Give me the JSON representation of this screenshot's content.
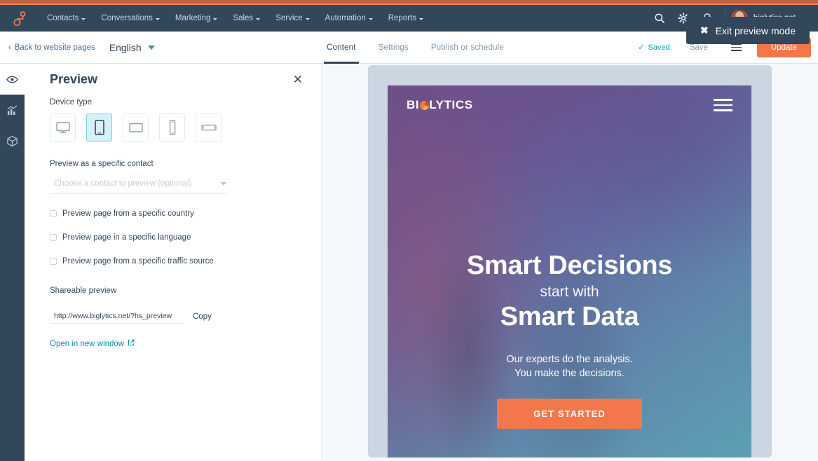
{
  "topbar": {
    "logo_icon": "hubspot-sprocket-icon",
    "nav_items": [
      {
        "label": "Contacts",
        "has_caret": true
      },
      {
        "label": "Conversations",
        "has_caret": true
      },
      {
        "label": "Marketing",
        "has_caret": true
      },
      {
        "label": "Sales",
        "has_caret": true
      },
      {
        "label": "Service",
        "has_caret": true
      },
      {
        "label": "Automation",
        "has_caret": true
      },
      {
        "label": "Reports",
        "has_caret": true
      }
    ],
    "icons": [
      "search-icon",
      "gear-icon",
      "bell-icon"
    ],
    "account_name": "biglytics.net",
    "avatar": "user-avatar"
  },
  "toolbar": {
    "back_label": "Back to website pages",
    "back_chevron": "‹",
    "language": "English",
    "tabs": [
      {
        "label": "Content",
        "active": true
      },
      {
        "label": "Settings",
        "active": false
      },
      {
        "label": "Publish or schedule",
        "active": false
      }
    ],
    "saved_label": "Saved",
    "saved_check": "✓",
    "save_label": "Save",
    "menu_icon": "hamburger-menu-icon",
    "update_label": "Update"
  },
  "rail": {
    "items": [
      {
        "name": "preview-eye-icon",
        "active": true
      },
      {
        "name": "analytics-chart-icon",
        "active": false
      },
      {
        "name": "modules-cube-icon",
        "active": false
      }
    ]
  },
  "panel": {
    "title": "Preview",
    "close_icon": "✕",
    "device_type_label": "Device type",
    "devices": [
      {
        "name": "desktop",
        "selected": false
      },
      {
        "name": "tablet-portrait",
        "selected": true
      },
      {
        "name": "tablet-landscape",
        "selected": false
      },
      {
        "name": "mobile-portrait",
        "selected": false
      },
      {
        "name": "mobile-landscape",
        "selected": false
      }
    ],
    "contact_label": "Preview as a specific contact",
    "contact_placeholder": "Choose a contact to preview (optional)",
    "checkboxes": [
      {
        "label": "Preview page from a specific country",
        "checked": false
      },
      {
        "label": "Preview page in a specific language",
        "checked": false
      },
      {
        "label": "Preview page from a specific traffic source",
        "checked": false
      }
    ],
    "shareable_label": "Shareable preview",
    "share_url": "http://www.biglytics.net/?hs_preview",
    "copy_label": "Copy",
    "open_new_label": "Open in new window",
    "open_new_icon": "external-link-icon"
  },
  "stage": {
    "exit_label": "Exit preview mode",
    "exit_icon": "✖"
  },
  "site_preview": {
    "logo_text_left": "BI",
    "logo_text_right": "LYTICS",
    "logo_mark": "pie-chart-circle",
    "menu_icon": "hamburger-menu-icon",
    "headline_1": "Smart Decisions",
    "headline_2": "start with",
    "headline_3": "Smart Data",
    "subtext_line1": "Our experts do the analysis.",
    "subtext_line2": "You make the decisions.",
    "cta_label": "GET STARTED"
  },
  "colors": {
    "nav_bg": "#33475b",
    "accent_orange": "#f2784b",
    "teal": "#00a4bd",
    "stage_bg": "#f5f8fa",
    "device_bezel": "#cbd6e2"
  }
}
